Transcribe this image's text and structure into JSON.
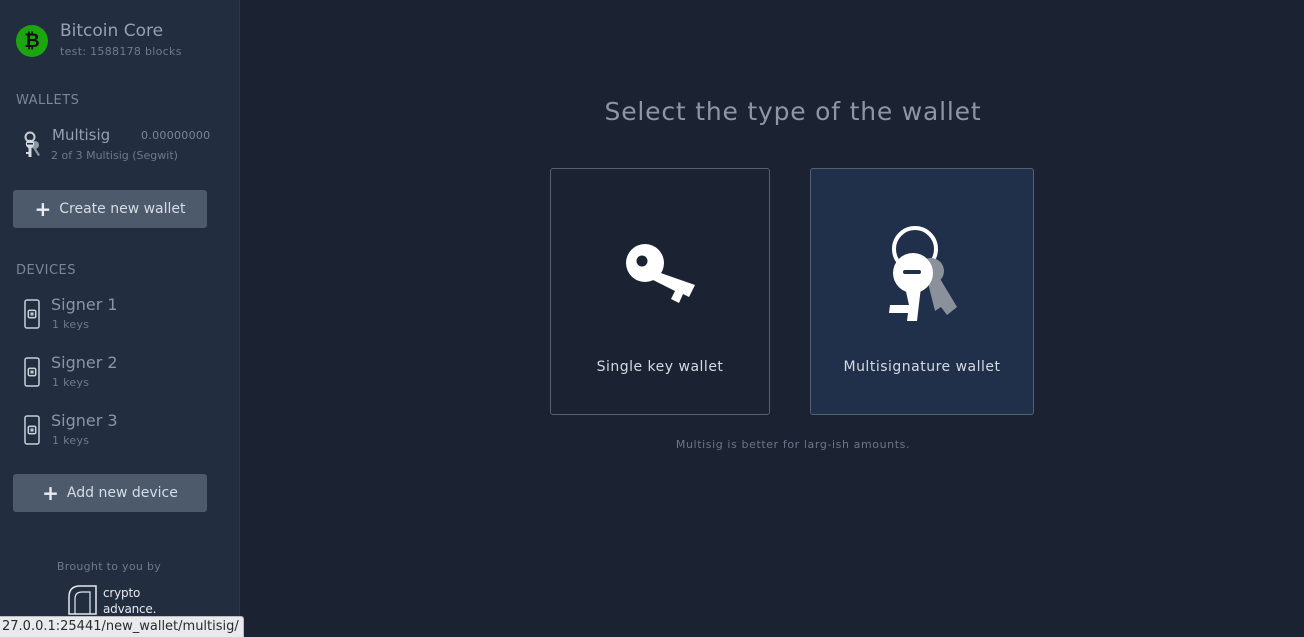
{
  "app": {
    "name": "Bitcoin Core",
    "status": "test: 1588178 blocks"
  },
  "sidebar": {
    "wallets_title": "WALLETS",
    "wallets": [
      {
        "name": "Multisig",
        "balance": "0.00000000",
        "description": "2 of 3 Multisig (Segwit)",
        "icon": "multisig-keys-icon"
      }
    ],
    "create_wallet_label": "Create new wallet",
    "devices_title": "DEVICES",
    "devices": [
      {
        "name": "Signer 1",
        "keys": "1 keys",
        "icon": "hardware-device-icon"
      },
      {
        "name": "Signer 2",
        "keys": "1 keys",
        "icon": "hardware-device-icon"
      },
      {
        "name": "Signer 3",
        "keys": "1 keys",
        "icon": "hardware-device-icon"
      }
    ],
    "add_device_label": "Add new device",
    "brought_by": "Brought to you by",
    "sponsor": {
      "line1": "crypto",
      "line2": "advance."
    }
  },
  "main": {
    "title": "Select the type of the wallet",
    "options": [
      {
        "label": "Single key wallet",
        "icon": "single-key-icon"
      },
      {
        "label": "Multisignature wallet",
        "icon": "multiple-keys-icon"
      }
    ],
    "hint": "Multisig is better for larg-ish amounts."
  },
  "statusbar": {
    "url": "27.0.0.1:25441/new_wallet/multisig/"
  },
  "colors": {
    "background": "#1b2332",
    "sidebar": "#222d3f",
    "bitcoin_logo": "#1ba60f",
    "button": "#4d5a6c",
    "selected_card": "#21304a"
  }
}
